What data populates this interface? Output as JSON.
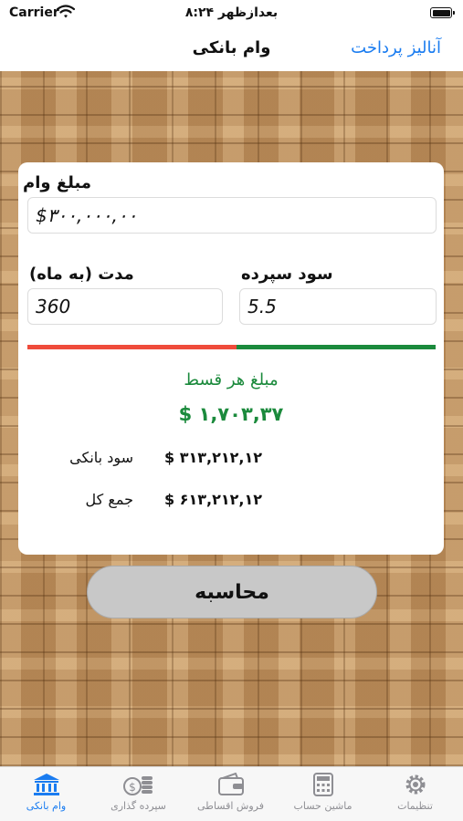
{
  "status_bar": {
    "carrier": "Carrier",
    "time": "۸:۲۴ بعدازظهر"
  },
  "nav": {
    "title": "وام بانکی",
    "analysis_link": "آنالیز پرداخت"
  },
  "form": {
    "loan_amount_label": "مبلغ وام",
    "loan_amount_value": "$۳۰۰,۰۰۰,۰۰",
    "duration_label": "مدت (به ماه)",
    "duration_value": "360",
    "interest_label": "سود سپرده",
    "interest_value": "5.5"
  },
  "result": {
    "installment_label": "مبلغ هر قسط",
    "installment_value": "$ ۱,۷۰۳,۳۷",
    "bank_interest_label": "سود بانکی",
    "bank_interest_value": "$ ۳۱۳,۲۱۲,۱۲",
    "total_label": "جمع کل",
    "total_value": "$ ۶۱۳,۲۱۲,۱۲"
  },
  "calculate_button": "محاسبه",
  "tabs": [
    {
      "label": "وام بانکی",
      "icon": "bank-icon",
      "active": true
    },
    {
      "label": "سپرده گذاری",
      "icon": "coins-icon",
      "active": false
    },
    {
      "label": "فروش اقساطی",
      "icon": "wallet-icon",
      "active": false
    },
    {
      "label": "ماشین حساب",
      "icon": "calculator-icon",
      "active": false
    },
    {
      "label": "تنظیمات",
      "icon": "gear-icon",
      "active": false
    }
  ],
  "colors": {
    "accent": "#1a7cf0",
    "positive": "#1b8a3c",
    "negative": "#ef4b3b"
  }
}
